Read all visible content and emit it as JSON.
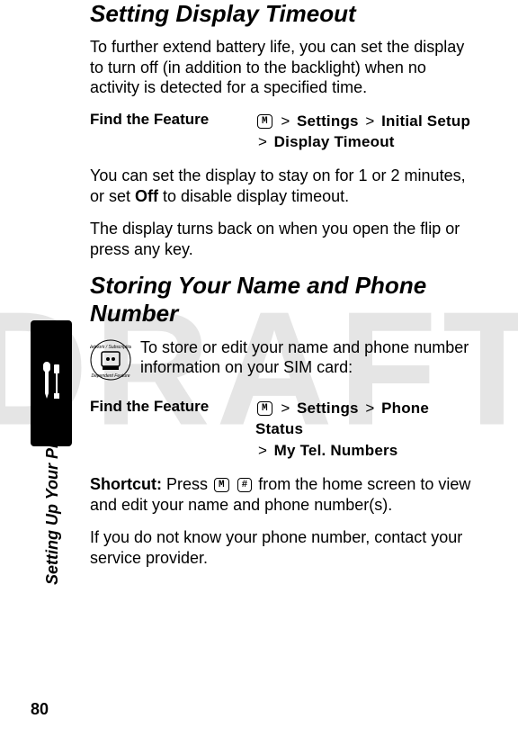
{
  "watermark": "DRAFT",
  "sideCaption": "Setting Up Your Phone",
  "pageNumber": "80",
  "section1": {
    "title": "Setting Display Timeout",
    "para1": "To further extend battery life, you can set the display to turn off (in addition to the backlight) when no activity is detected for a specified time.",
    "featureLabel": "Find the Feature",
    "menuBtn": "M",
    "path1a": "Settings",
    "path1b": "Initial Setup",
    "path1c": "Display Timeout",
    "para2_pre": "You can set the display to stay on for 1 or 2 minutes, or set ",
    "offWord": "Off",
    "para2_post": " to disable display timeout.",
    "para3": "The display turns back on when you open the flip or press any key."
  },
  "section2": {
    "title": "Storing Your Name and Phone Number",
    "simPara": "To store or edit your name and phone number information on your SIM card:",
    "featureLabel": "Find the Feature",
    "menuBtn": "M",
    "path2a": "Settings",
    "path2b": "Phone Status",
    "path2c": "My Tel. Numbers",
    "shortcutLabel": "Shortcut:",
    "shortcutPre": " Press ",
    "btnM": "M",
    "btnHash": "#",
    "shortcutPost": " from the home screen to view and edit your name and phone number(s).",
    "para4": "If you do not know your phone number, contact your service provider."
  },
  "gt": ">"
}
